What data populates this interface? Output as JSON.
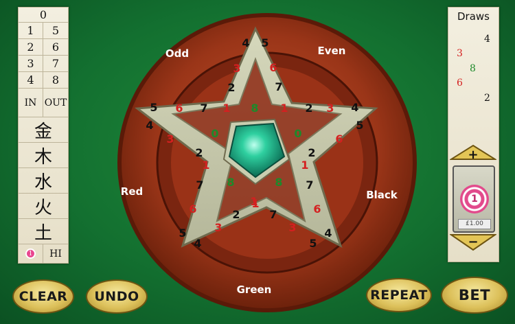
{
  "left_table": {
    "zero": "0",
    "pairs": [
      [
        "1",
        "5"
      ],
      [
        "2",
        "6"
      ],
      [
        "3",
        "7"
      ],
      [
        "4",
        "8"
      ]
    ],
    "in_label": "IN",
    "out_label": "OUT",
    "elements": [
      "金",
      "木",
      "水",
      "火",
      "土"
    ],
    "lo_chip": "1",
    "hi_label": "HI"
  },
  "wheel": {
    "labels": {
      "odd": "Odd",
      "even": "Even",
      "red": "Red",
      "black": "Black",
      "green": "Green"
    },
    "numbers": [
      {
        "v": "4",
        "c": "black"
      },
      {
        "v": "5",
        "c": "black"
      },
      {
        "v": "3",
        "c": "red"
      },
      {
        "v": "6",
        "c": "red"
      },
      {
        "v": "2",
        "c": "black"
      },
      {
        "v": "7",
        "c": "black"
      },
      {
        "v": "5",
        "c": "black"
      },
      {
        "v": "6",
        "c": "red"
      },
      {
        "v": "7",
        "c": "black"
      },
      {
        "v": "1",
        "c": "red"
      },
      {
        "v": "8",
        "c": "green"
      },
      {
        "v": "1",
        "c": "red"
      },
      {
        "v": "2",
        "c": "black"
      },
      {
        "v": "3",
        "c": "red"
      },
      {
        "v": "4",
        "c": "black"
      },
      {
        "v": "4",
        "c": "black"
      },
      {
        "v": "3",
        "c": "red"
      },
      {
        "v": "0",
        "c": "green"
      },
      {
        "v": "0",
        "c": "green"
      },
      {
        "v": "6",
        "c": "red"
      },
      {
        "v": "5",
        "c": "black"
      },
      {
        "v": "2",
        "c": "black"
      },
      {
        "v": "1",
        "c": "red"
      },
      {
        "v": "1",
        "c": "red"
      },
      {
        "v": "2",
        "c": "black"
      },
      {
        "v": "7",
        "c": "black"
      },
      {
        "v": "8",
        "c": "green"
      },
      {
        "v": "8",
        "c": "green"
      },
      {
        "v": "7",
        "c": "black"
      },
      {
        "v": "6",
        "c": "red"
      },
      {
        "v": "1",
        "c": "red"
      },
      {
        "v": "1",
        "c": "red"
      },
      {
        "v": "6",
        "c": "red"
      },
      {
        "v": "3",
        "c": "red"
      },
      {
        "v": "2",
        "c": "black"
      },
      {
        "v": "7",
        "c": "black"
      },
      {
        "v": "3",
        "c": "red"
      },
      {
        "v": "5",
        "c": "black"
      },
      {
        "v": "4",
        "c": "black"
      },
      {
        "v": "5",
        "c": "black"
      },
      {
        "v": "4",
        "c": "black"
      }
    ]
  },
  "draws": {
    "title": "Draws",
    "history": [
      {
        "v": "4",
        "c": "black"
      },
      {
        "v": "3",
        "c": "red"
      },
      {
        "v": "8",
        "c": "green"
      },
      {
        "v": "6",
        "c": "red"
      },
      {
        "v": "2",
        "c": "black"
      }
    ]
  },
  "chip": {
    "denomination": "1",
    "value": "£1.00"
  },
  "buttons": {
    "plus": "+",
    "minus": "−",
    "clear": "CLEAR",
    "undo": "UNDO",
    "repeat": "REPEAT",
    "bet": "BET"
  },
  "colors": {
    "red": "#d42020",
    "black": "#111111",
    "green": "#1c8a2a"
  }
}
